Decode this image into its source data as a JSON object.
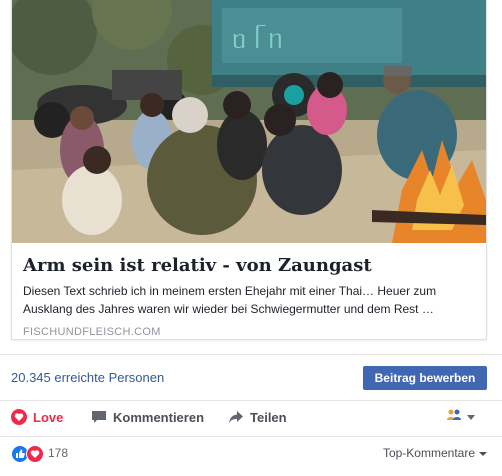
{
  "link_preview": {
    "title": "Arm sein ist relativ - von Zaungast",
    "description": "Diesen Text schrieb ich in meinem ersten Ehejahr mit einer Thai… Heuer zum Ausklang des Jahres waren wir wieder bei Schwiegermutter und dem Rest …",
    "domain": "FISCHUNDFLEISCH.COM"
  },
  "reach": {
    "text": "20.345 erreichte Personen",
    "boost_label": "Beitrag bewerben"
  },
  "actions": {
    "love_label": "Love",
    "comment_label": "Kommentieren",
    "share_label": "Teilen"
  },
  "reactions": {
    "count": "178",
    "sort_label": "Top-Kommentare"
  },
  "icons": {
    "love": "heart-outline-icon",
    "comment": "speech-bubble-icon",
    "share": "share-arrow-icon",
    "audience": "friends-icon",
    "like_reaction": "thumbs-up-icon",
    "love_reaction": "heart-icon"
  },
  "colors": {
    "link": "#365899",
    "button": "#4267b2",
    "love": "#f0284a",
    "like": "#1877f2"
  }
}
